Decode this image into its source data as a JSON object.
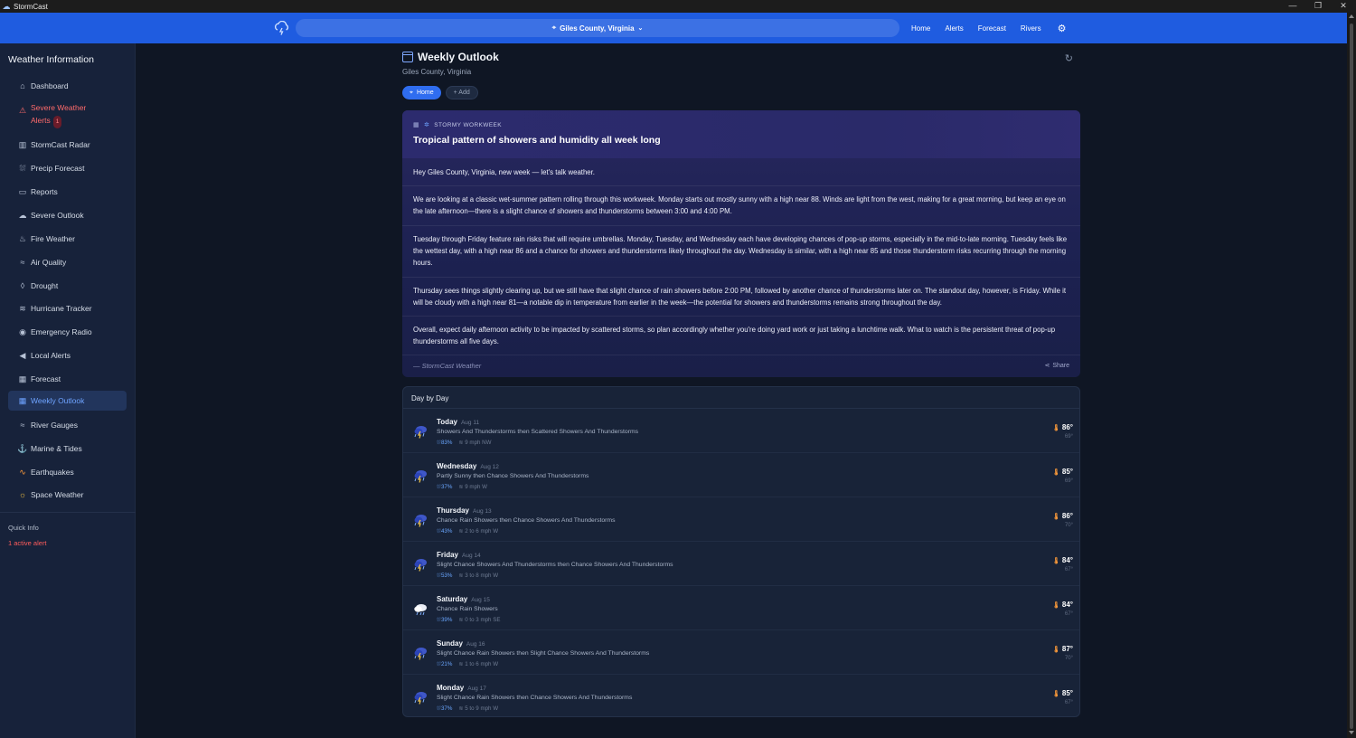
{
  "window": {
    "title": "StormCast",
    "controls": [
      "—",
      "❐",
      "✕"
    ]
  },
  "topnav": {
    "location": "Giles County, Virginia",
    "links": [
      "Home",
      "Alerts",
      "Forecast",
      "Rivers"
    ]
  },
  "sidebar": {
    "title": "Weather Information",
    "items": [
      {
        "label": "Dashboard",
        "icon": "home-icon"
      },
      {
        "label": "Severe Weather Alerts",
        "icon": "warning-icon",
        "badge": "1"
      },
      {
        "label": "StormCast Radar",
        "icon": "map-icon"
      },
      {
        "label": "Precip Forecast",
        "icon": "raindrop-icon"
      },
      {
        "label": "Reports",
        "icon": "chat-icon"
      },
      {
        "label": "Severe Outlook",
        "icon": "storm-icon"
      },
      {
        "label": "Fire Weather",
        "icon": "flame-icon"
      },
      {
        "label": "Air Quality",
        "icon": "wind-icon"
      },
      {
        "label": "Drought",
        "icon": "drop-icon"
      },
      {
        "label": "Hurricane Tracker",
        "icon": "hurricane-icon"
      },
      {
        "label": "Emergency Radio",
        "icon": "radio-icon"
      },
      {
        "label": "Local Alerts",
        "icon": "megaphone-icon"
      },
      {
        "label": "Forecast",
        "icon": "calendar-icon"
      },
      {
        "label": "Weekly Outlook",
        "icon": "calendar-icon"
      },
      {
        "label": "River Gauges",
        "icon": "waves-icon"
      },
      {
        "label": "Marine & Tides",
        "icon": "anchor-icon"
      },
      {
        "label": "Earthquakes",
        "icon": "pulse-icon"
      },
      {
        "label": "Space Weather",
        "icon": "sun-icon"
      }
    ],
    "quick_info_title": "Quick Info",
    "quick_info_alert": "1 active alert"
  },
  "page": {
    "title": "Weekly Outlook",
    "subtitle": "Giles County, Virginia",
    "chips": {
      "home": "Home",
      "add": "+ Add"
    }
  },
  "story": {
    "kicker": "STORMY WORKWEEK",
    "headline": "Tropical pattern of showers and humidity all week long",
    "paragraphs": [
      "Hey Giles County, Virginia, new week — let's talk weather.",
      "We are looking at a classic wet-summer pattern rolling through this workweek. Monday starts out mostly sunny with a high near 88. Winds are light from the west, making for a great morning, but keep an eye on the late afternoon—there is a slight chance of showers and thunderstorms between 3:00 and 4:00 PM.",
      "Tuesday through Friday feature rain risks that will require umbrellas. Monday, Tuesday, and Wednesday each have developing chances of pop-up storms, especially in the mid-to-late morning. Tuesday feels like the wettest day, with a high near 86 and a chance for showers and thunderstorms likely throughout the day. Wednesday is similar, with a high near 85 and those thunderstorm risks recurring through the morning hours.",
      "Thursday sees things slightly clearing up, but we still have that slight chance of rain showers before 2:00 PM, followed by another chance of thunderstorms later on. The standout day, however, is Friday. While it will be cloudy with a high near 81—a notable dip in temperature from earlier in the week—the potential for showers and thunderstorms remains strong throughout the day.",
      "Overall, expect daily afternoon activity to be impacted by scattered storms, so plan accordingly whether you're doing yard work or just taking a lunchtime walk. What to watch is the persistent threat of pop-up thunderstorms all five days."
    ],
    "byline": "— StormCast Weather",
    "share": "Share"
  },
  "days": {
    "title": "Day by Day",
    "rows": [
      {
        "day": "Today",
        "date": "Aug 11",
        "desc": "Showers And Thunderstorms then Scattered Showers And Thunderstorms",
        "pop": "83%",
        "wind": "9 mph NW",
        "hi": "86°",
        "lo": "69°",
        "icon": "thunderstorm-icon"
      },
      {
        "day": "Wednesday",
        "date": "Aug 12",
        "desc": "Partly Sunny then Chance Showers And Thunderstorms",
        "pop": "37%",
        "wind": "9 mph W",
        "hi": "85°",
        "lo": "69°",
        "icon": "thunderstorm-icon"
      },
      {
        "day": "Thursday",
        "date": "Aug 13",
        "desc": "Chance Rain Showers then Chance Showers And Thunderstorms",
        "pop": "43%",
        "wind": "2 to 6 mph W",
        "hi": "86°",
        "lo": "70°",
        "icon": "thunderstorm-icon"
      },
      {
        "day": "Friday",
        "date": "Aug 14",
        "desc": "Slight Chance Showers And Thunderstorms then Chance Showers And Thunderstorms",
        "pop": "53%",
        "wind": "3 to 8 mph W",
        "hi": "84°",
        "lo": "67°",
        "icon": "thunderstorm-icon"
      },
      {
        "day": "Saturday",
        "date": "Aug 15",
        "desc": "Chance Rain Showers",
        "pop": "39%",
        "wind": "0 to 3 mph SE",
        "hi": "84°",
        "lo": "67°",
        "icon": "rain-cloud-icon"
      },
      {
        "day": "Sunday",
        "date": "Aug 16",
        "desc": "Slight Chance Rain Showers then Slight Chance Showers And Thunderstorms",
        "pop": "21%",
        "wind": "1 to 6 mph W",
        "hi": "87°",
        "lo": "70°",
        "icon": "thunderstorm-icon"
      },
      {
        "day": "Monday",
        "date": "Aug 17",
        "desc": "Slight Chance Rain Showers then Chance Showers And Thunderstorms",
        "pop": "37%",
        "wind": "5 to 9 mph W",
        "hi": "85°",
        "lo": "67°",
        "icon": "thunderstorm-icon"
      }
    ]
  }
}
